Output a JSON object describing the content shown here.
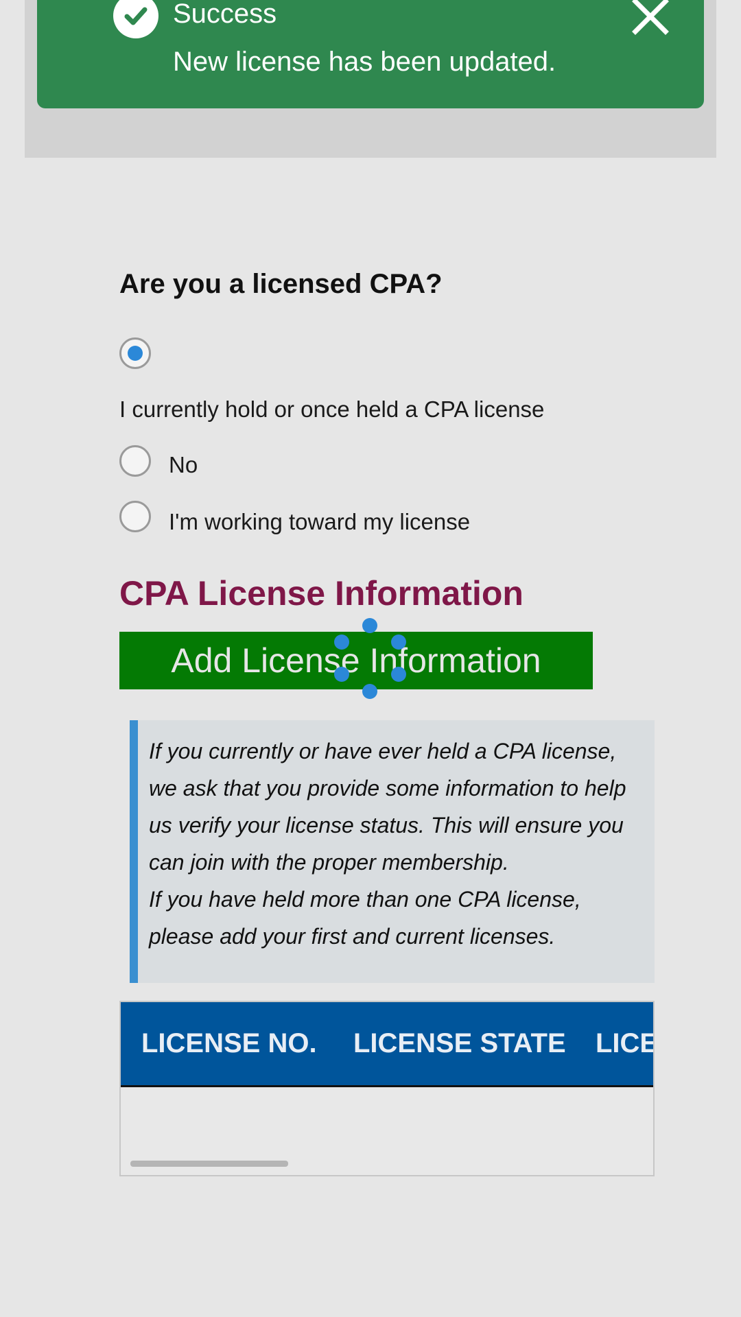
{
  "toast": {
    "title": "Success",
    "message": "New license has been updated.",
    "icon": "check-circle-icon",
    "close_icon": "close-icon",
    "color": "#2f884f"
  },
  "question": {
    "label": "Are you a licensed CPA?",
    "options": [
      {
        "label": "I currently hold or once held a CPA license",
        "selected": true
      },
      {
        "label": "No",
        "selected": false
      },
      {
        "label": "I'm working toward my license",
        "selected": false
      }
    ]
  },
  "section": {
    "title": "CPA License Information",
    "title_color": "#7f1748"
  },
  "add_button": {
    "label": "Add License Information",
    "color": "#047a04"
  },
  "info": {
    "paragraph1": "If you currently or have ever held a CPA license, we ask that you provide some information to help us verify your license status. This will ensure you can join with the proper membership.",
    "paragraph2": "If you have held more than one CPA license, please add your first and current licenses."
  },
  "table": {
    "header_color": "#00559b",
    "columns": [
      "LICENSE NO.",
      "LICENSE STATE",
      "LICE"
    ]
  }
}
